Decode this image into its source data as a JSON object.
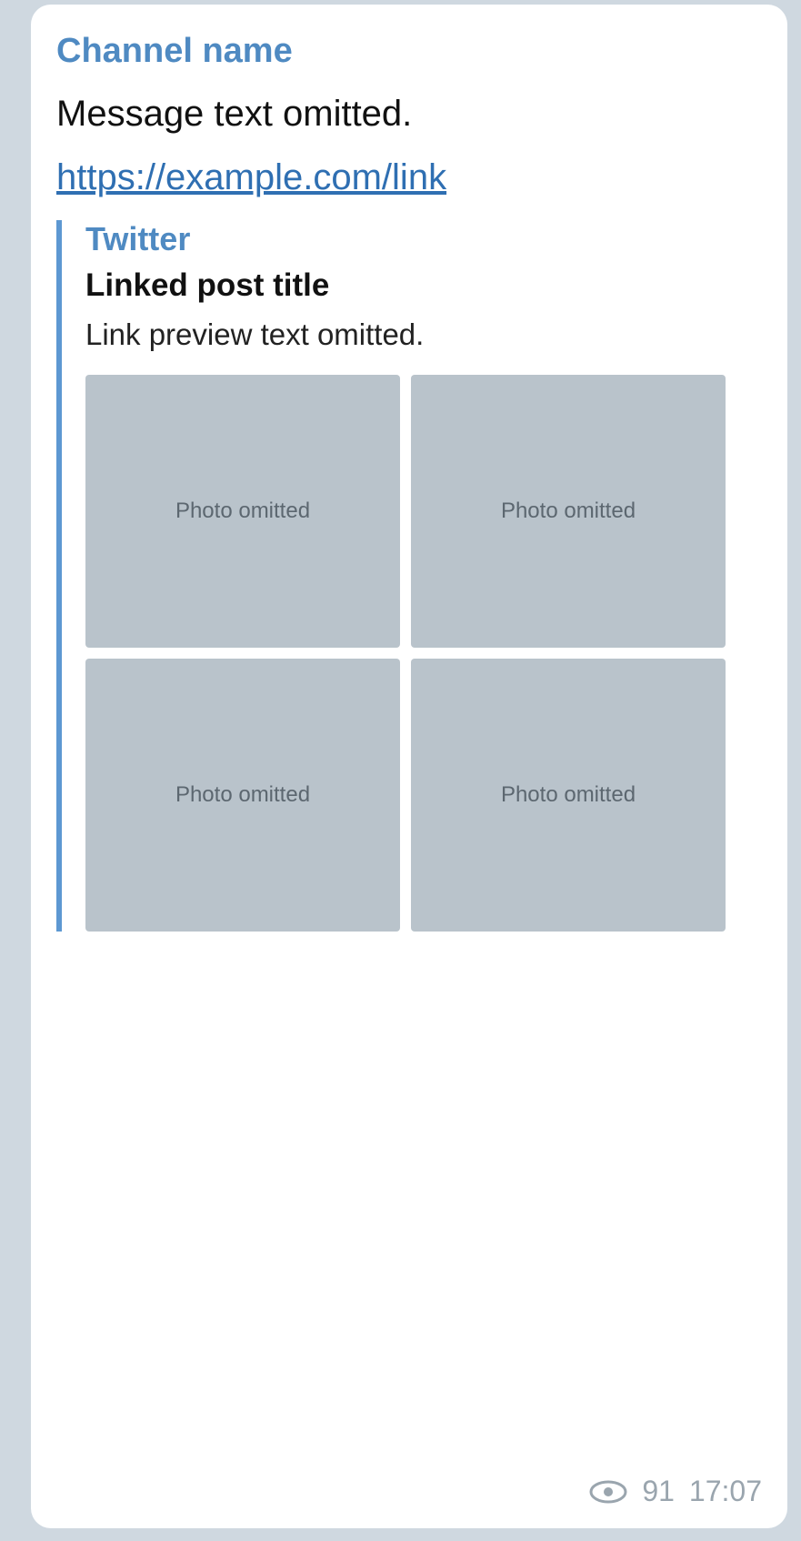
{
  "message": {
    "sender": "Channel name",
    "text": "Message text omitted.",
    "link": "https://example.com/link"
  },
  "preview": {
    "site": "Twitter",
    "title": "Linked post title",
    "description": "Link preview text omitted."
  },
  "media": {
    "placeholder": "Photo omitted"
  },
  "footer": {
    "views": "91",
    "time": "17:07"
  }
}
